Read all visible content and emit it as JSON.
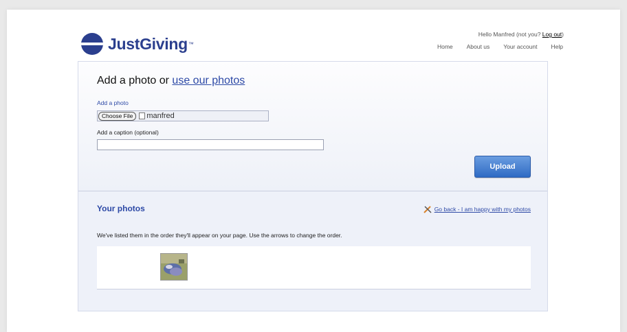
{
  "header": {
    "logo_text": "JustGiving",
    "logo_tm": "™",
    "greeting_text": "Hello Manfred (not you? ",
    "logout_label": "Log out",
    "greeting_close": ")",
    "nav": [
      "Home",
      "About us",
      "Your account",
      "Help"
    ]
  },
  "upload": {
    "title_prefix": "Add a photo or ",
    "title_link": "use our photos",
    "add_photo_label": "Add a photo",
    "choose_file_label": "Choose File",
    "file_name": "manfred",
    "caption_label": "Add a caption (optional)",
    "caption_value": "",
    "upload_button": "Upload"
  },
  "photos": {
    "title": "Your photos",
    "go_back_label": "Go back - I am happy with my photos",
    "instructions": "We've listed them in the order they'll appear on your page. Use the arrows to change the order."
  },
  "colors": {
    "brand": "#2b3f8e",
    "link": "#2d49a6",
    "button": "#2f6bc4"
  }
}
